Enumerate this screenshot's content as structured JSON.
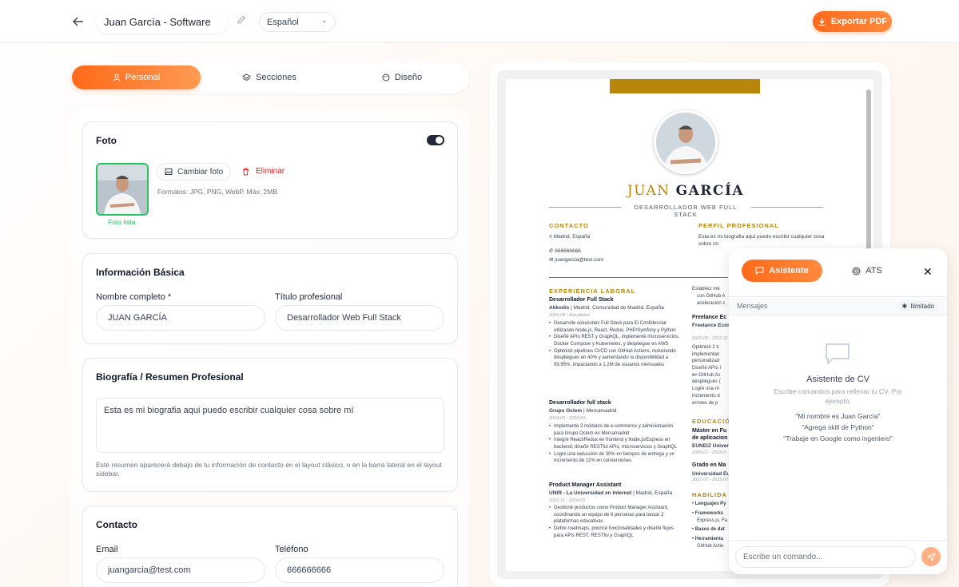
{
  "header": {
    "document_title": "Juan García - Software",
    "language": "Español",
    "export_label": "Exportar PDF"
  },
  "tabs": [
    {
      "label": "Personal"
    },
    {
      "label": "Secciones"
    },
    {
      "label": "Diseño"
    }
  ],
  "photo": {
    "title": "Foto",
    "change_label": "Cambiar foto",
    "delete_label": "Eliminar",
    "formats": "Formatos: JPG, PNG, WebP. Máx: 2MB",
    "status": "Foto lista"
  },
  "basic": {
    "title": "Información Básica",
    "name_label": "Nombre completo *",
    "name_value": "JUAN GARCÍA",
    "title_label": "Título profesional",
    "title_value": "Desarrollador Web Full Stack"
  },
  "bio": {
    "title": "Biografía / Resumen Profesional",
    "value": "Esta es mi biografia aqui puedo escribir cualquier cosa sobre mí",
    "help": "Este resumen aparecerá debajo de tu información de contacto en el layout clásico, o en la barra lateral en el layout sidebar."
  },
  "contact": {
    "title": "Contacto",
    "email_label": "Email",
    "email_value": "juangarcia@test.com",
    "phone_label": "Teléfono",
    "phone_value": "666666666"
  },
  "cv": {
    "first_name": "JUAN",
    "last_name": "GARCÍA",
    "role": "DESARROLLADOR WEB FULL STACK",
    "contact_heading": "CONTACTO",
    "location": "Madrid, España",
    "phone": "666666666",
    "email": "juangarcia@test.com",
    "profile_heading": "PERFIL PROFESIONAL",
    "profile_text": "Esta es mi biografia aqui puedo escribir cualquier cosa sobre mí",
    "experience_heading": "EXPERIENCIA LABORAL",
    "jobs": [
      {
        "title": "Desarrollador Full Stack",
        "company": "Akkodis",
        "place": "| Madrid, Comunidad de Madrid, España",
        "dates": "2025-09 - Actualidad",
        "bullets": [
          "Desarrolle soluciones Full Stack para El Confidencial utilizando Node.js, React, Redux, PHP/Symfony y Python",
          "Diseñé APIs REST y GraphQL, implementé microservicios, Docker Compose y Kubernetes, y despliegue en AWS",
          "Optimizé pipelines CI/CD con GitHub Actions, reduciendo despliegues en 40% y aumentando la disponibilidad a 99.95%, impactando a 1.2M de usuarios mensuales"
        ]
      },
      {
        "title": "Desarrollador full stack",
        "company": "Grupo Oclem",
        "place": "| Mercamadrid",
        "dates": "2024-03 - 2025-09",
        "bullets": [
          "Implementé 3 módulos de e-commerce y administración para Grupo Oclem en Mercamadrid",
          "Integré React/Redux en frontend y Node.js/Express en backend; diseñé RESTful APIs, microservicios y GraphQL",
          "Logré una reducción de 30% en tiempos de entrega y un incremento de 12% en conversiones"
        ]
      },
      {
        "title": "Product Manager Assistant",
        "company": "UNIR - La Universidad en Internet",
        "place": "| Madrid, España",
        "dates": "2022-11 - 2024-03",
        "bullets": [
          "Gestioné productos como Product Manager Assistant, coordinando un equipo de 6 personas para lanzar 2 plataformas educativas",
          "Definí roadmaps, prioricé funcionalidades y diseñé flujos para APIs REST, RESTful y GraphQL"
        ]
      }
    ],
    "right_col": {
      "bullet_a1": "Establecí mé",
      "bullet_a2": "con GitHub A",
      "bullet_a3": "aceleración c",
      "freelance_title": "Freelance Ec",
      "freelance_company": "Freelance Econ",
      "freelance_dates": "2020-06 - 2022-11",
      "fb1": "Optimizé 2 ti",
      "fb2": "implementan",
      "fb3": "personalizad",
      "fb4": "Diseñé APIs I",
      "fb5": "en GitHub Ac",
      "fb6": "despliegues (",
      "fb7": "Logré una m",
      "fb8": "incremento d",
      "fb9": "errores de p",
      "education_heading": "EDUCACIÓ",
      "edu1_title": "Máster en Fu",
      "edu1_sub": "de aplicacion",
      "edu1_school": "EUNEIZ Univer",
      "edu1_dates": "2025-01 - 2025-0",
      "edu2_title": "Grado en Ma",
      "edu2_school": "Universidad Eu",
      "edu2_dates": "2021-07 - 2025-07",
      "skills_heading": "HABILIDA",
      "skill1": "Lenguajes Py",
      "skill2": "Frameworks",
      "skill2b": "Express.js, Fa",
      "skill3": "Bases de dat",
      "skill4": "Herramienta",
      "skill4b": "GitHub Actio"
    }
  },
  "assistant": {
    "tab_assistant": "Asistente",
    "tab_ats": "ATS",
    "messages_label": "Mensajes",
    "unlimited_label": "Ilimitado",
    "empty_title": "Asistente de CV",
    "empty_sub": "Escribe comandos para rellenar tu CV. Por ejemplo:",
    "examples": [
      "\"Mi nombre es Juan García\"",
      "\"Agrega skill de Python\"",
      "\"Trabaje en Google como ingeniero\""
    ],
    "input_placeholder": "Escribe un comando..."
  },
  "colors": {
    "accent": "#ff6a1a",
    "cv_gold": "#b8860b",
    "success": "#22c55e",
    "danger": "#dc2626"
  }
}
